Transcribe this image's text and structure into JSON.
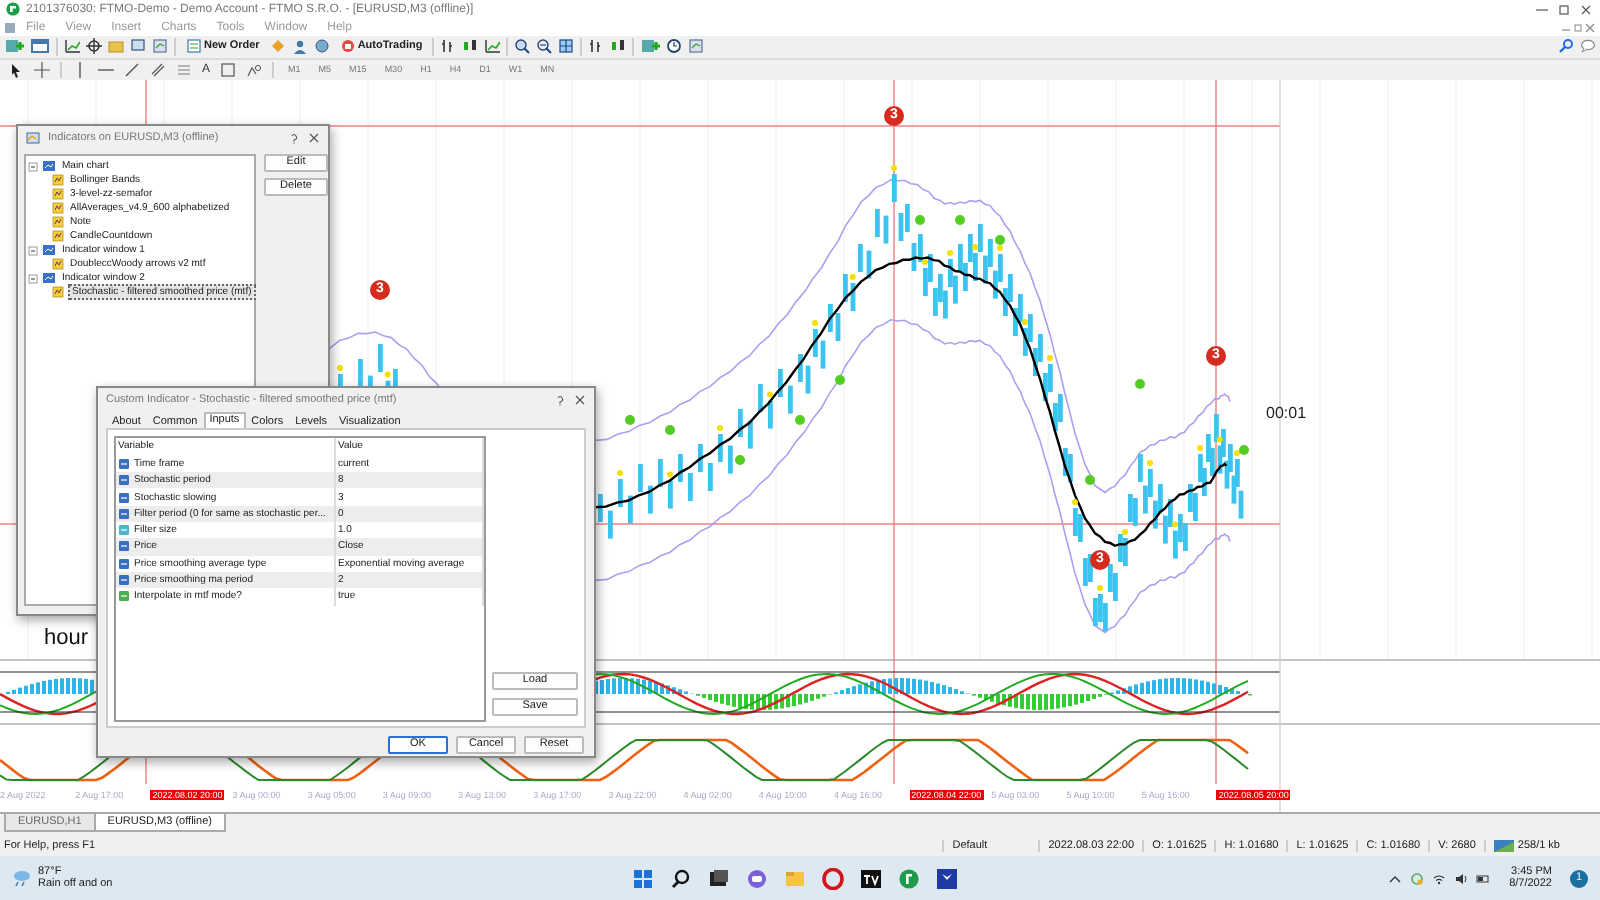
{
  "window": {
    "title": "2101376030: FTMO-Demo - Demo Account - FTMO S.R.O. - [EURUSD,M3 (offline)]"
  },
  "menu": [
    "File",
    "View",
    "Insert",
    "Charts",
    "Tools",
    "Window",
    "Help"
  ],
  "toolbar": {
    "new_order": "New Order",
    "autotrading": "AutoTrading",
    "text_tool": "A"
  },
  "timeframes": [
    {
      "label": "M1",
      "disabled": true
    },
    {
      "label": "M5",
      "disabled": true
    },
    {
      "label": "M15",
      "disabled": true
    },
    {
      "label": "M30",
      "disabled": true
    },
    {
      "label": "H1",
      "disabled": true
    },
    {
      "label": "H4",
      "disabled": true
    },
    {
      "label": "D1",
      "disabled": true
    },
    {
      "label": "W1",
      "disabled": true
    },
    {
      "label": "MN",
      "disabled": true
    }
  ],
  "chart": {
    "countdown": "00:01",
    "overlay_text": "hour",
    "signals": [
      {
        "label": "3"
      },
      {
        "label": "3"
      },
      {
        "label": "3"
      },
      {
        "label": "3"
      }
    ],
    "time_labels": [
      {
        "label": "2 Aug 2022",
        "highlight": false
      },
      {
        "label": "2 Aug 17:00",
        "highlight": false
      },
      {
        "label": "2022.08.02 20:00",
        "highlight": true
      },
      {
        "label": "3 Aug 00:00",
        "highlight": false
      },
      {
        "label": "3 Aug 05:00",
        "highlight": false
      },
      {
        "label": "3 Aug 09:00",
        "highlight": false
      },
      {
        "label": "3 Aug 13:00",
        "highlight": false
      },
      {
        "label": "3 Aug 17:00",
        "highlight": false
      },
      {
        "label": "3 Aug 22:00",
        "highlight": false
      },
      {
        "label": "4 Aug 02:00",
        "highlight": false
      },
      {
        "label": "4 Aug 10:00",
        "highlight": false
      },
      {
        "label": "4 Aug 16:00",
        "highlight": false
      },
      {
        "label": "2022.08.04 22:00",
        "highlight": true
      },
      {
        "label": "5 Aug 03:00",
        "highlight": false
      },
      {
        "label": "5 Aug 10:00",
        "highlight": false
      },
      {
        "label": "5 Aug 16:00",
        "highlight": false
      },
      {
        "label": "2022.08.05 20:00",
        "highlight": true
      }
    ]
  },
  "indicators_dialog": {
    "title": "Indicators on EURUSD,M3 (offline)",
    "buttons": [
      "Edit",
      "Delete"
    ],
    "tree": [
      {
        "label": "Main chart",
        "kind": "window",
        "selected": false,
        "children": [
          {
            "label": "Bollinger Bands",
            "kind": "indicator",
            "selected": false
          },
          {
            "label": "3-level-zz-semafor",
            "kind": "indicator",
            "selected": false
          },
          {
            "label": "AllAverages_v4.9_600 alphabetized",
            "kind": "indicator",
            "selected": false
          },
          {
            "label": "Note",
            "kind": "indicator",
            "selected": false
          },
          {
            "label": "CandleCountdown",
            "kind": "indicator",
            "selected": false
          }
        ]
      },
      {
        "label": "Indicator window 1",
        "kind": "window",
        "selected": false,
        "children": [
          {
            "label": "DoubleccWoody arrows v2 mtf",
            "kind": "indicator",
            "selected": false
          }
        ]
      },
      {
        "label": "Indicator window 2",
        "kind": "window",
        "selected": false,
        "children": [
          {
            "label": "Stochastic - filtered smoothed price (mtf)",
            "kind": "indicator",
            "selected": true
          }
        ]
      }
    ]
  },
  "inputs_dialog": {
    "title": "Custom Indicator - Stochastic - filtered smoothed price (mtf)",
    "tabs": [
      {
        "label": "About",
        "selected": false
      },
      {
        "label": "Common",
        "selected": false
      },
      {
        "label": "Inputs",
        "selected": true
      },
      {
        "label": "Colors",
        "selected": false
      },
      {
        "label": "Levels",
        "selected": false
      },
      {
        "label": "Visualization",
        "selected": false
      }
    ],
    "columns": [
      "Variable",
      "Value"
    ],
    "rows": [
      {
        "variable": "Time frame",
        "value": "current",
        "kind": "int"
      },
      {
        "variable": "Stochastic period",
        "value": "8",
        "kind": "int"
      },
      {
        "variable": "Stochastic slowing",
        "value": "3",
        "kind": "int"
      },
      {
        "variable": "Filter period (0 for same as stochastic per...",
        "value": "0",
        "kind": "int"
      },
      {
        "variable": "Filter size",
        "value": "1.0",
        "kind": "double"
      },
      {
        "variable": "Price",
        "value": "Close",
        "kind": "int"
      },
      {
        "variable": "Price smoothing average type",
        "value": "Exponential moving average",
        "kind": "int"
      },
      {
        "variable": "Price smoothing ma period",
        "value": "2",
        "kind": "int"
      },
      {
        "variable": "Interpolate in mtf mode?",
        "value": "true",
        "kind": "bool"
      }
    ],
    "side_buttons": [
      "Load",
      "Save"
    ],
    "buttons": [
      "OK",
      "Cancel",
      "Reset"
    ]
  },
  "chart_tabs": [
    {
      "label": "EURUSD,H1",
      "selected": false
    },
    {
      "label": "EURUSD,M3 (offline)",
      "selected": true
    }
  ],
  "status_bar": {
    "help": "For Help, press F1",
    "profile": "Default",
    "time": "2022.08.03 22:00",
    "open": "O: 1.01625",
    "high": "H: 1.01680",
    "low": "L: 1.01625",
    "close": "C: 1.01680",
    "volume": "V: 2680",
    "traffic": "258/1 kb"
  },
  "taskbar": {
    "temperature": "87°F",
    "weather": "Rain off and on",
    "time": "3:45 PM",
    "date": "8/7/2022",
    "notifications": "1"
  }
}
